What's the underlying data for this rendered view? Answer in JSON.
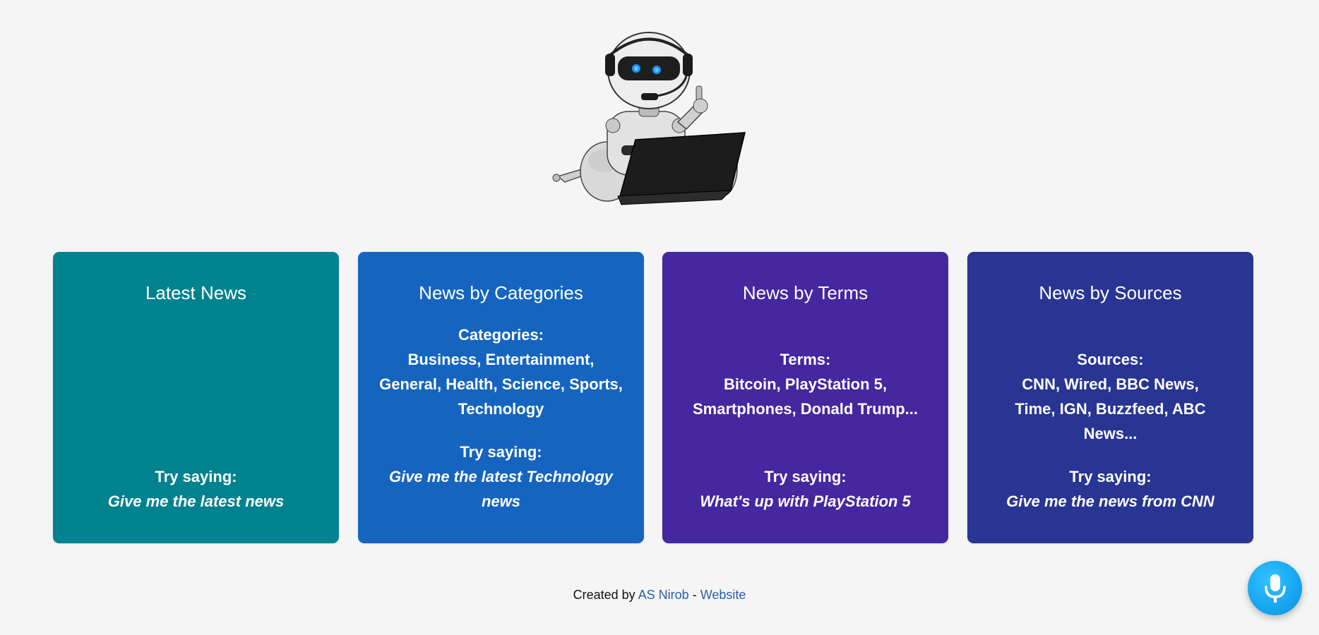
{
  "hero": {
    "image": "robot-with-laptop-illustration"
  },
  "cards": [
    {
      "title": "Latest News",
      "label": "",
      "items": "",
      "try_label": "Try saying:",
      "try_phrase": "Give me the latest news",
      "color": "#00838f"
    },
    {
      "title": "News by Categories",
      "label": "Categories:",
      "items": "Business, Entertainment, General, Health, Science, Sports, Technology",
      "try_label": "Try saying:",
      "try_phrase": "Give me the latest Technology news",
      "color": "#1565c0"
    },
    {
      "title": "News by Terms",
      "label": "Terms:",
      "items": "Bitcoin, PlayStation 5, Smartphones, Donald Trump...",
      "try_label": "Try saying:",
      "try_phrase": "What's up with PlayStation 5",
      "color": "#4527a0"
    },
    {
      "title": "News by Sources",
      "label": "Sources:",
      "items": "CNN, Wired, BBC News, Time, IGN, Buzzfeed, ABC News...",
      "try_label": "Try saying:",
      "try_phrase": "Give me the news from CNN",
      "color": "#283593"
    }
  ],
  "footer": {
    "prefix": "Created by",
    "author": "AS Nirob",
    "separator": "-",
    "website": "Website"
  },
  "mic": {
    "icon": "microphone-icon",
    "color": "#18a7f2"
  }
}
